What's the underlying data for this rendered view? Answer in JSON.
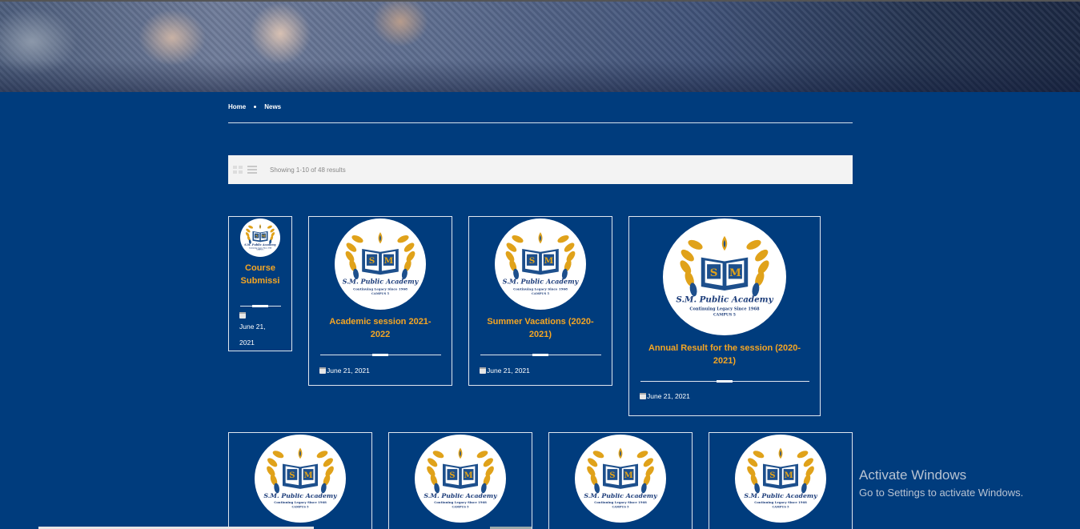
{
  "breadcrumb": {
    "home": "Home",
    "current": "News"
  },
  "toolbar": {
    "result_count": "Showing 1-10 of 48 results"
  },
  "logo": {
    "initials": "SM",
    "name": "S.M. Public Academy",
    "tagline": "Continuing Legacy Since 1968",
    "campus": "CAMPUS 5"
  },
  "cards": [
    {
      "title": "Course Submissi",
      "date": "June 21, 2021"
    },
    {
      "title": "Academic session 2021-2022",
      "date": "June 21, 2021"
    },
    {
      "title": "Summer Vacations (2020-2021)",
      "date": "June 21, 2021"
    },
    {
      "title": "Annual Result for the session (2020-2021)",
      "date": "June 21, 2021"
    }
  ],
  "watermark": {
    "title": "Activate Windows",
    "subtitle": "Go to Settings to activate Windows."
  },
  "colors": {
    "background": "#003c7d",
    "accent": "#f5a623",
    "toolbar_bg": "#f3f3f3"
  }
}
